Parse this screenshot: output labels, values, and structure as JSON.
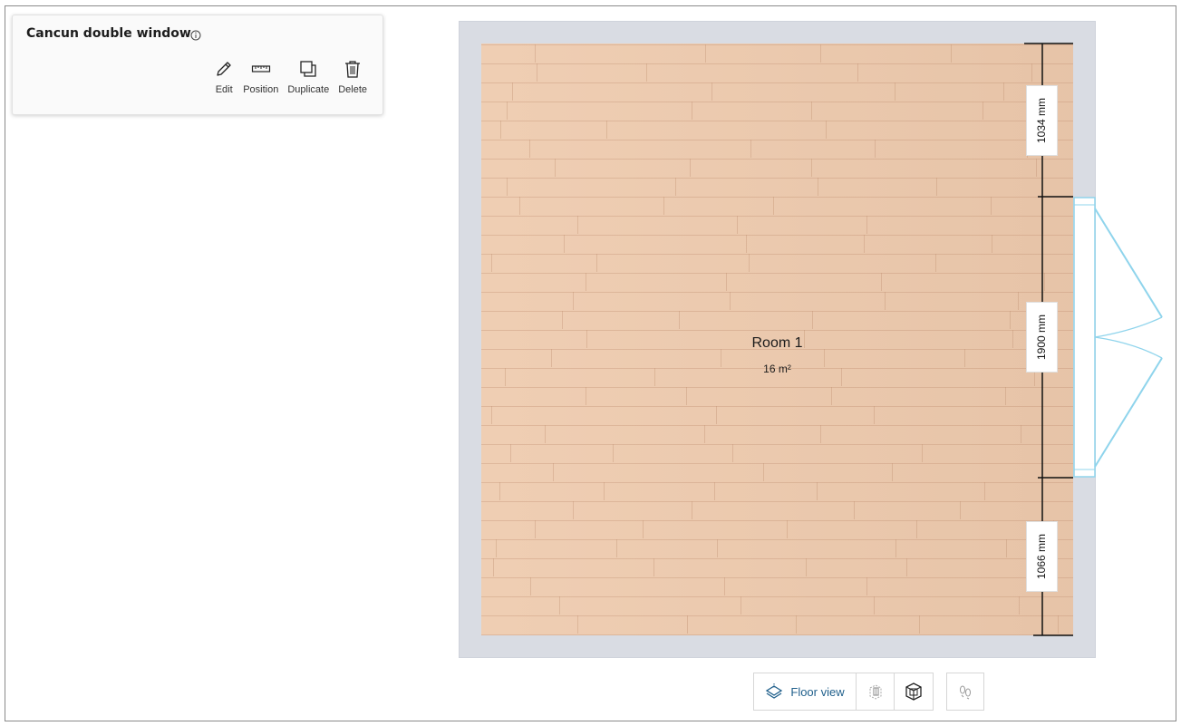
{
  "panel": {
    "title": "Cancun double window",
    "actions": [
      {
        "label": "Edit",
        "icon": "pencil-icon"
      },
      {
        "label": "Position",
        "icon": "ruler-icon"
      },
      {
        "label": "Duplicate",
        "icon": "duplicate-icon"
      },
      {
        "label": "Delete",
        "icon": "trash-icon"
      }
    ]
  },
  "room": {
    "name": "Room 1",
    "area": "16 m²"
  },
  "dimensions": {
    "top": "1034 mm",
    "window": "1900 mm",
    "bottom": "1066 mm"
  },
  "toolbar": {
    "floor_view_label": "Floor view",
    "active": "floor-view"
  },
  "colors": {
    "wall": "#d9dce3",
    "floor": "#eecaad",
    "window": "#8fd4ec",
    "accent": "#1f5f8b"
  }
}
